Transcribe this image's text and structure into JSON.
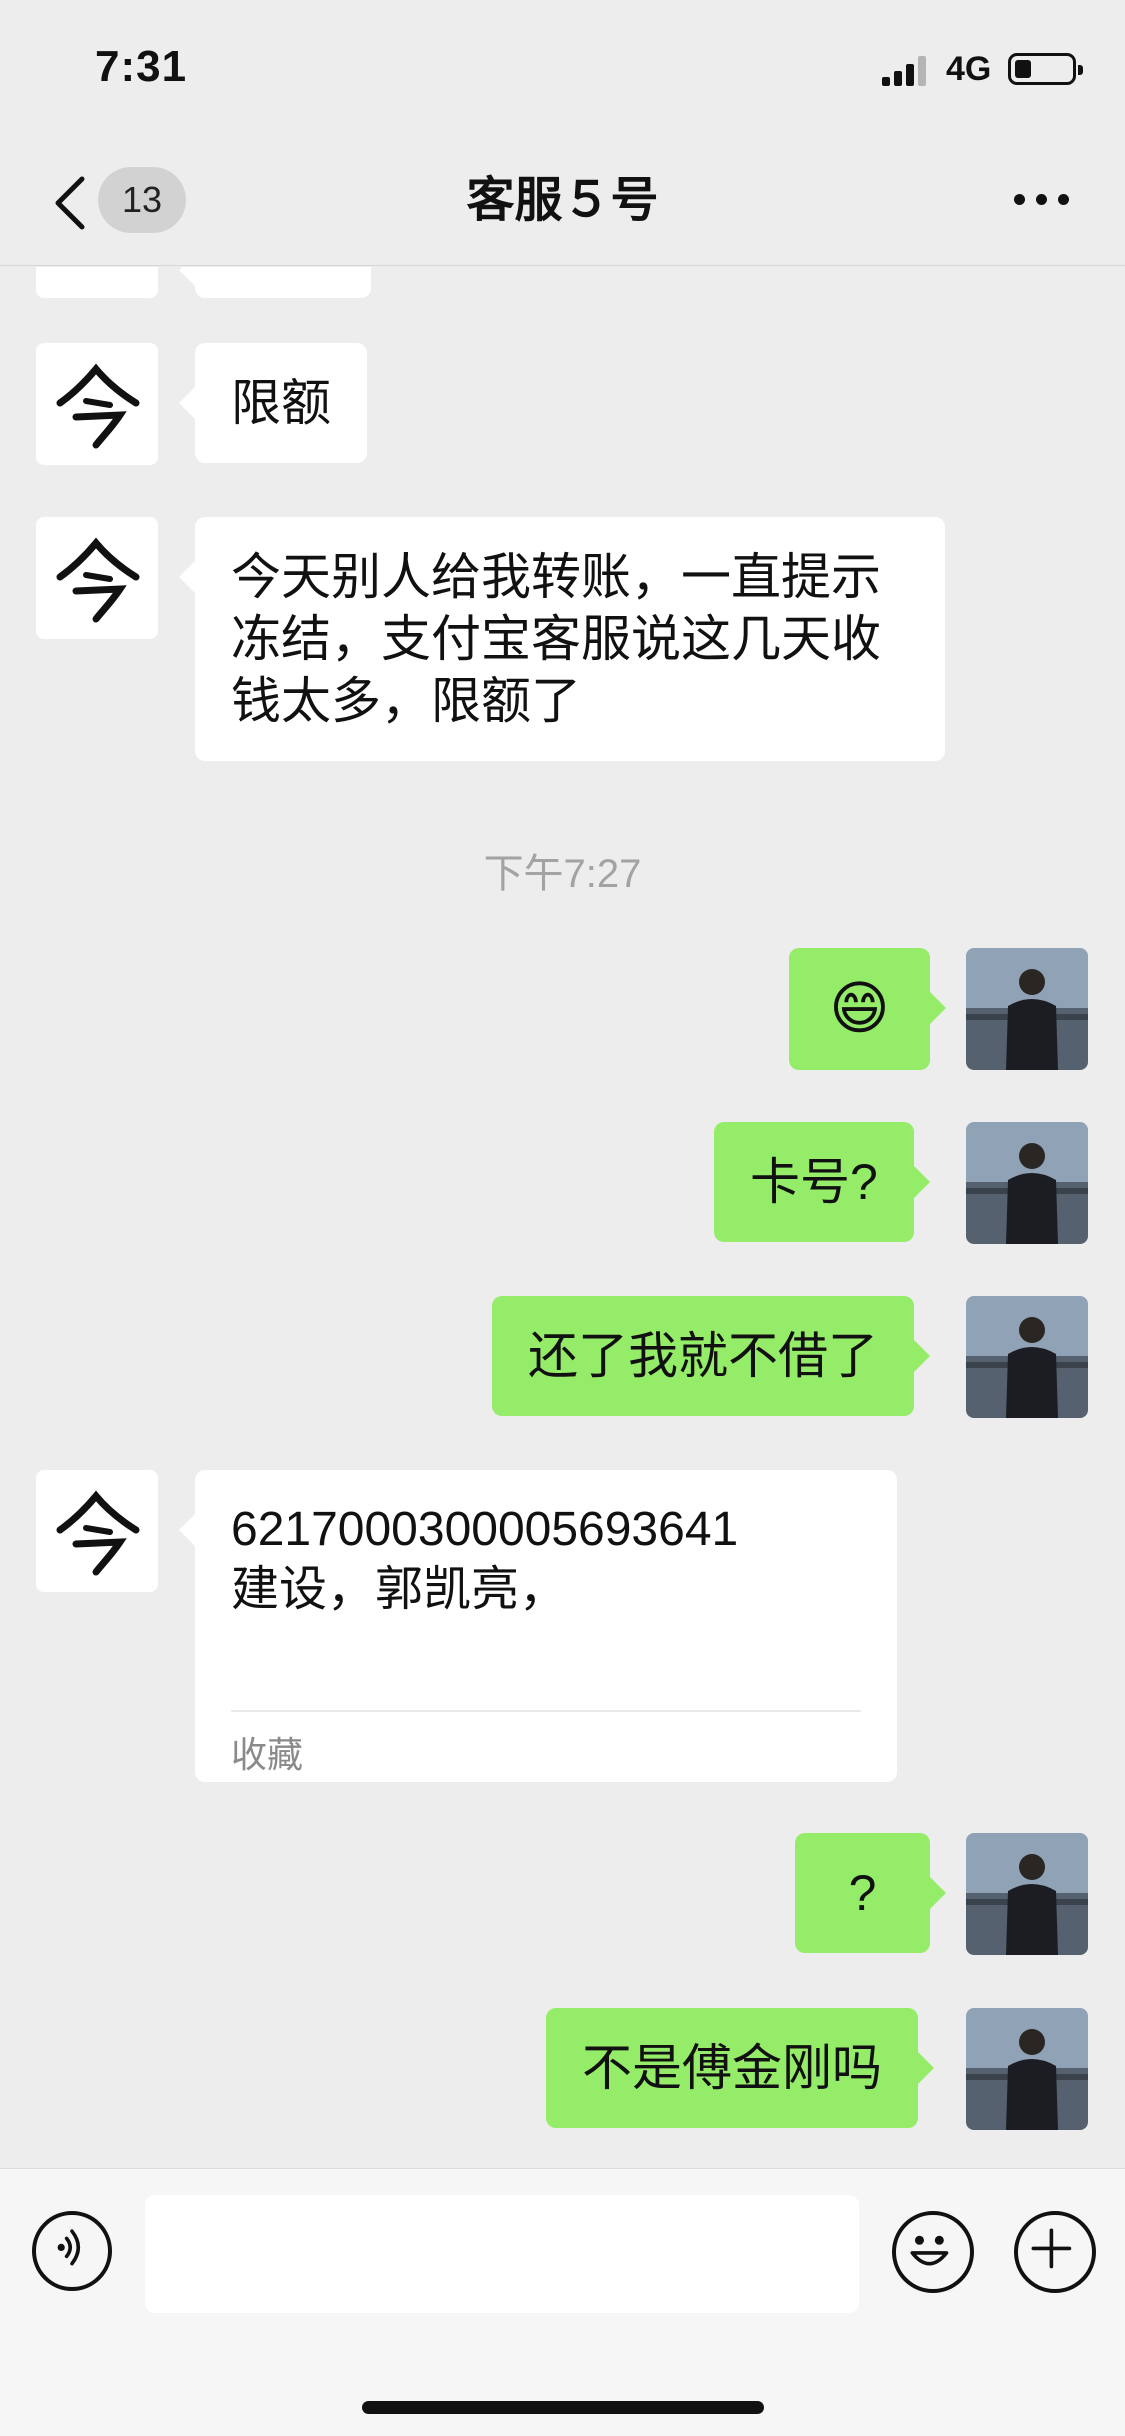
{
  "status_bar": {
    "time": "7:31",
    "network": "4G"
  },
  "nav": {
    "unread_count": "13",
    "title": "客服５号"
  },
  "messages": {
    "msg1": "限额",
    "msg2": "今天别人给我转账，一直提示冻结，支付宝客服说这几天收钱太多，限额了",
    "timestamp": "下午7:27",
    "msg3": "😄",
    "msg4": "卡号?",
    "msg5": "还了我就不借了",
    "card_text": "6217000300005693641\n建设，郭凯亮，",
    "card_label": "收藏",
    "msg6": "?",
    "msg7": "不是傅金刚吗"
  },
  "input": {
    "placeholder": ""
  },
  "colors": {
    "background": "#ededed",
    "outgoing_bubble": "#95ec69",
    "incoming_bubble": "#ffffff",
    "timestamp": "#a3a3a3"
  },
  "icons": {
    "back": "chevron-left-icon",
    "more": "more-dots-icon",
    "voice": "voice-icon",
    "emoji": "emoji-icon",
    "plus": "plus-icon",
    "signal": "signal-icon",
    "battery": "battery-icon"
  }
}
